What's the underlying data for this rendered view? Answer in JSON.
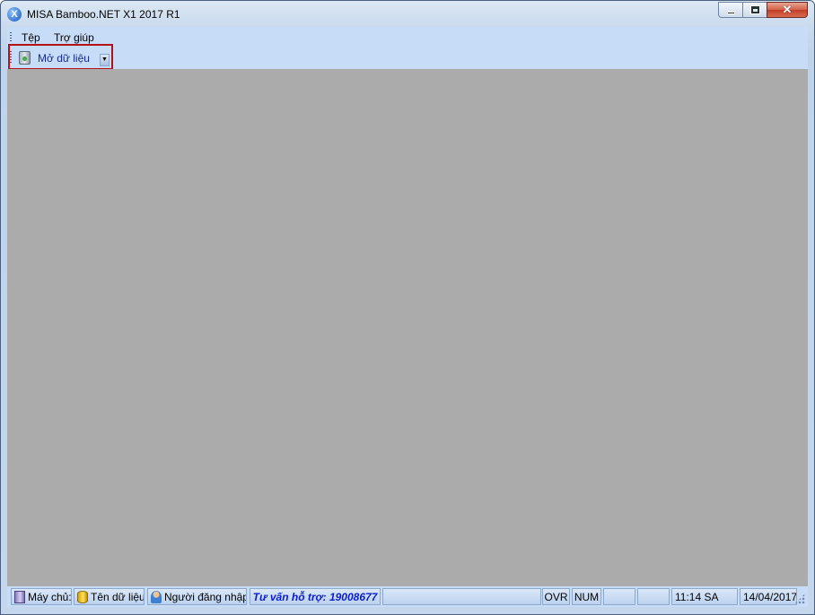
{
  "window": {
    "title": "MISA Bamboo.NET X1 2017 R1"
  },
  "menubar": {
    "items": [
      {
        "label": "Tệp"
      },
      {
        "label": "Trợ giúp"
      }
    ]
  },
  "toolbar": {
    "open_data_label": "Mở dữ liệu"
  },
  "statusbar": {
    "server_label": "Máy chủ:",
    "database_label": "Tên dữ liệu:",
    "login_user_label": "Người đăng nhập:",
    "support_text": "Tư vấn hỗ trợ: 19008677",
    "ovr": "OVR",
    "num": "NUM",
    "time": "11:14 SA",
    "date": "14/04/2017"
  },
  "colors": {
    "workspace": "#ababab",
    "highlight_border": "#b3121b",
    "support_text": "#0b1fc9"
  }
}
